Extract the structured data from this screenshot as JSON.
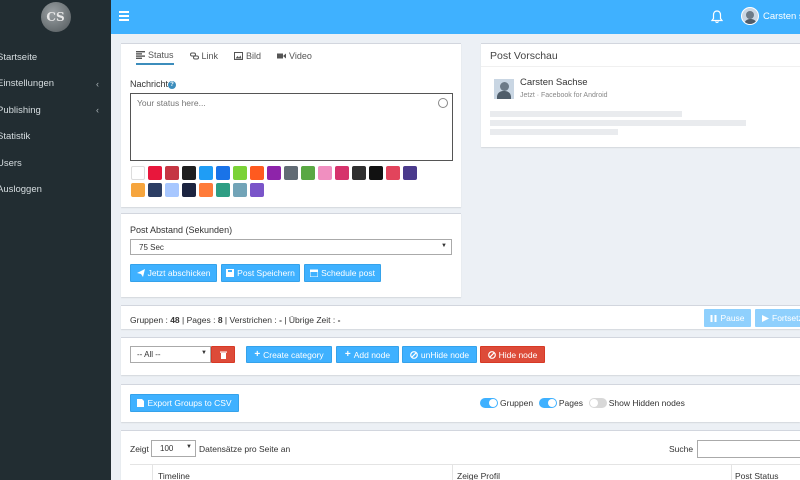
{
  "sidebar": {
    "logo_text": "CS",
    "items": [
      {
        "label": "Startseite",
        "chevron": false
      },
      {
        "label": "Einstellungen",
        "chevron": true
      },
      {
        "label": "Publishing",
        "chevron": true
      },
      {
        "label": "Statistik",
        "chevron": false
      },
      {
        "label": "Users",
        "chevron": false
      },
      {
        "label": "Ausloggen",
        "chevron": false
      }
    ],
    "chevron_glyph": "‹"
  },
  "topbar": {
    "user_name": "Carsten sachse",
    "bell_icon": "bell-icon",
    "menu_icon": "hamburger-icon"
  },
  "composer": {
    "tabs": [
      {
        "label": "Status",
        "icon": "status-icon"
      },
      {
        "label": "Link",
        "icon": "link-icon"
      },
      {
        "label": "Bild",
        "icon": "image-icon"
      },
      {
        "label": "Video",
        "icon": "video-icon"
      }
    ],
    "message_label": "Nachricht",
    "message_placeholder": "Your status here...",
    "swatch_row1": [
      "#ffffff",
      "#e8173c",
      "#c53643",
      "#1f1f1f",
      "#1f9df5",
      "#1a73e8",
      "#7bd236",
      "#ff5a1f",
      "#8e24aa",
      "#616b74",
      "#5aa843",
      "#f08fc0",
      "#d6336c",
      "#2f2f2f",
      "#111111",
      "#e2445c",
      "#4a3a8c"
    ],
    "swatch_row2": [
      "#f6a53d",
      "#2c3e64",
      "#a7c7ff",
      "#1c2440",
      "#ff7b3a",
      "#2e9e84",
      "#72a4b8",
      "#7a55c9"
    ]
  },
  "post_settings": {
    "label": "Post Abstand (Sekunden)",
    "selected": "75 Sec",
    "buttons": {
      "send_now": "Jetzt abschicken",
      "save_post": "Post Speichern",
      "schedule": "Schedule post"
    }
  },
  "preview": {
    "title": "Post Vorschau",
    "name": "Carsten Sachse",
    "meta": "Jetzt · Facebook for Android"
  },
  "stats": {
    "groups_label": "Gruppen :",
    "groups_value": "48",
    "pages_label": "| Pages :",
    "pages_value": "8",
    "elapsed_label": "| Verstrichen :",
    "elapsed_value": "-",
    "remaining_label": "| Übrige Zeit :",
    "remaining_value": "-",
    "pause_label": "Pause",
    "continue_label": "Fortsetzen"
  },
  "category_bar": {
    "select_value": "-- All --",
    "create_category": "Create category",
    "add_node": "Add node",
    "unhide_node": "unHide node",
    "hide_node": "Hide node"
  },
  "export_bar": {
    "export_label": "Export Groups to CSV",
    "toggle_groups": "Gruppen",
    "toggle_pages": "Pages",
    "toggle_hidden": "Show Hidden nodes"
  },
  "table": {
    "show_prefix": "Zeigt",
    "page_size": "100",
    "show_suffix": "Datensätze pro Seite an",
    "search_label": "Suche",
    "columns": [
      "Timeline",
      "Zeige Profil",
      "Post Status"
    ]
  }
}
